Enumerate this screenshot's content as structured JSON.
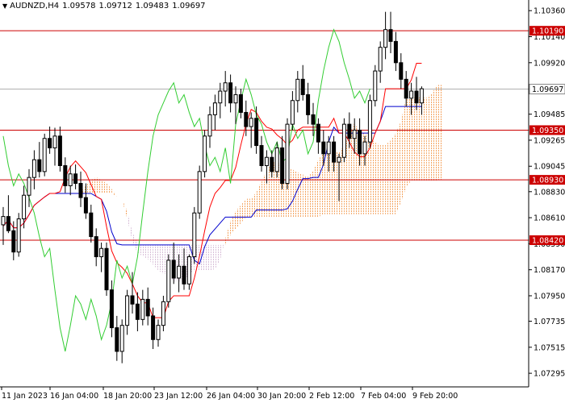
{
  "header": {
    "symbol": "AUDNZD,H4",
    "open": "1.09578",
    "high": "1.09712",
    "low": "1.09483",
    "close": "1.09697"
  },
  "chart_data": {
    "type": "candlestick",
    "symbol": "AUDNZD",
    "timeframe": "H4",
    "price_range": [
      1.0718,
      1.1045
    ],
    "x_labels": [
      "11 Jan 2023",
      "16 Jan 04:00",
      "18 Jan 20:00",
      "23 Jan 12:00",
      "26 Jan 04:00",
      "30 Jan 20:00",
      "2 Feb 12:00",
      "7 Feb 04:00",
      "9 Feb 20:00"
    ],
    "y_ticks": [
      "1.10360",
      "1.10140",
      "1.09920",
      "1.09485",
      "1.09265",
      "1.09045",
      "1.08830",
      "1.08610",
      "1.08390",
      "1.08170",
      "1.07950",
      "1.07735",
      "1.07515",
      "1.07295"
    ],
    "levels": [
      {
        "value": 1.1019,
        "label": "1.10190"
      },
      {
        "value": 1.0935,
        "label": "1.09350"
      },
      {
        "value": 1.0893,
        "label": "1.08930"
      },
      {
        "value": 1.0842,
        "label": "1.08420"
      }
    ],
    "current_price": {
      "value": 1.09697,
      "label": "1.09697"
    },
    "candles": [
      [
        1.0855,
        1.087,
        1.0838,
        1.0862
      ],
      [
        1.0862,
        1.088,
        1.0848,
        1.085
      ],
      [
        1.085,
        1.0858,
        1.0825,
        1.0832
      ],
      [
        1.0832,
        1.0865,
        1.0828,
        1.086
      ],
      [
        1.086,
        1.0888,
        1.0852,
        1.088
      ],
      [
        1.088,
        1.0902,
        1.087,
        1.0895
      ],
      [
        1.0895,
        1.0918,
        1.0885,
        1.091
      ],
      [
        1.091,
        1.0925,
        1.0895,
        1.09
      ],
      [
        1.09,
        1.0932,
        1.0896,
        1.0928
      ],
      [
        1.0928,
        1.0938,
        1.0915,
        1.092
      ],
      [
        1.092,
        1.0937,
        1.0905,
        1.093
      ],
      [
        1.093,
        1.0938,
        1.09,
        1.0905
      ],
      [
        1.0905,
        1.0912,
        1.0882,
        1.0888
      ],
      [
        1.0888,
        1.0905,
        1.088,
        1.0898
      ],
      [
        1.0898,
        1.0906,
        1.0885,
        1.089
      ],
      [
        1.089,
        1.09,
        1.087,
        1.0878
      ],
      [
        1.0878,
        1.089,
        1.086,
        1.0865
      ],
      [
        1.0865,
        1.0872,
        1.084,
        1.0845
      ],
      [
        1.0845,
        1.0852,
        1.082,
        1.0828
      ],
      [
        1.0828,
        1.084,
        1.0815,
        1.0835
      ],
      [
        1.0835,
        1.084,
        1.0795,
        1.08
      ],
      [
        1.08,
        1.0808,
        1.076,
        1.0768
      ],
      [
        1.0768,
        1.0778,
        1.074,
        1.0748
      ],
      [
        1.0748,
        1.0775,
        1.0738,
        1.077
      ],
      [
        1.077,
        1.08,
        1.0762,
        1.0795
      ],
      [
        1.0795,
        1.0815,
        1.078,
        1.0788
      ],
      [
        1.0788,
        1.0798,
        1.0765,
        1.0775
      ],
      [
        1.0775,
        1.08,
        1.077,
        1.0792
      ],
      [
        1.0792,
        1.0802,
        1.077,
        1.0778
      ],
      [
        1.0778,
        1.0785,
        1.075,
        1.0758
      ],
      [
        1.0758,
        1.0775,
        1.0752,
        1.077
      ],
      [
        1.077,
        1.0795,
        1.0765,
        1.079
      ],
      [
        1.079,
        1.083,
        1.0785,
        1.0825
      ],
      [
        1.0825,
        1.084,
        1.0805,
        1.081
      ],
      [
        1.081,
        1.083,
        1.0798,
        1.082
      ],
      [
        1.082,
        1.0835,
        1.08,
        1.0805
      ],
      [
        1.0805,
        1.083,
        1.08,
        1.0828
      ],
      [
        1.0828,
        1.087,
        1.0822,
        1.0865
      ],
      [
        1.0865,
        1.0905,
        1.086,
        1.09
      ],
      [
        1.09,
        1.0935,
        1.0895,
        1.093
      ],
      [
        1.093,
        1.0955,
        1.092,
        1.0948
      ],
      [
        1.0948,
        1.0965,
        1.0935,
        1.0958
      ],
      [
        1.0958,
        1.0975,
        1.0945,
        1.0968
      ],
      [
        1.0968,
        1.0985,
        1.0955,
        1.0975
      ],
      [
        1.0975,
        1.0982,
        1.095,
        1.0958
      ],
      [
        1.0958,
        1.0972,
        1.094,
        1.0965
      ],
      [
        1.0965,
        1.097,
        1.0945,
        1.095
      ],
      [
        1.095,
        1.096,
        1.093,
        1.0938
      ],
      [
        1.0938,
        1.095,
        1.092,
        1.0945
      ],
      [
        1.0945,
        1.0955,
        1.0915,
        1.0922
      ],
      [
        1.0922,
        1.093,
        1.09,
        1.0905
      ],
      [
        1.0905,
        1.0918,
        1.089,
        1.0912
      ],
      [
        1.0912,
        1.0918,
        1.0895,
        1.09
      ],
      [
        1.09,
        1.0925,
        1.0895,
        1.092
      ],
      [
        1.092,
        1.093,
        1.0885,
        1.089
      ],
      [
        1.089,
        1.0945,
        1.0885,
        1.094
      ],
      [
        1.094,
        1.0968,
        1.0935,
        1.096
      ],
      [
        1.096,
        1.0985,
        1.095,
        1.0978
      ],
      [
        1.0978,
        1.099,
        1.096,
        1.0965
      ],
      [
        1.0965,
        1.0975,
        1.094,
        1.0948
      ],
      [
        1.0948,
        1.0958,
        1.093,
        1.094
      ],
      [
        1.094,
        1.0945,
        1.0915,
        1.0925
      ],
      [
        1.0925,
        1.0935,
        1.0905,
        1.0915
      ],
      [
        1.0915,
        1.093,
        1.09,
        1.0925
      ],
      [
        1.0925,
        1.093,
        1.09,
        1.0908
      ],
      [
        1.0908,
        1.0915,
        1.0875,
        1.0912
      ],
      [
        1.0912,
        1.0945,
        1.0908,
        1.094
      ],
      [
        1.094,
        1.095,
        1.092,
        1.0928
      ],
      [
        1.0928,
        1.0945,
        1.0915,
        1.0935
      ],
      [
        1.0935,
        1.0945,
        1.0905,
        1.0915
      ],
      [
        1.0915,
        1.093,
        1.0905,
        1.0925
      ],
      [
        1.0925,
        1.0965,
        1.092,
        1.096
      ],
      [
        1.096,
        1.099,
        1.0955,
        1.0985
      ],
      [
        1.0985,
        1.101,
        1.0975,
        1.1005
      ],
      [
        1.1005,
        1.1035,
        1.0995,
        1.102
      ],
      [
        1.102,
        1.1035,
        1.1,
        1.101
      ],
      [
        1.101,
        1.1018,
        1.0985,
        1.0992
      ],
      [
        1.0992,
        1.1,
        1.097,
        1.0978
      ],
      [
        1.0978,
        1.0985,
        1.0955,
        1.0962
      ],
      [
        1.0962,
        1.0975,
        1.0948,
        1.0968
      ],
      [
        1.0968,
        1.098,
        1.0952,
        1.0958
      ],
      [
        1.0958,
        1.0972,
        1.0948,
        1.097
      ]
    ],
    "ichimoku": {
      "tenkan_color": "#ff0000",
      "kijun_color": "#0000cd",
      "chikou_color": "#32cd32",
      "cloud_colors": {
        "bullish": "#f4a460",
        "bearish": "#d8bfd8"
      }
    }
  }
}
